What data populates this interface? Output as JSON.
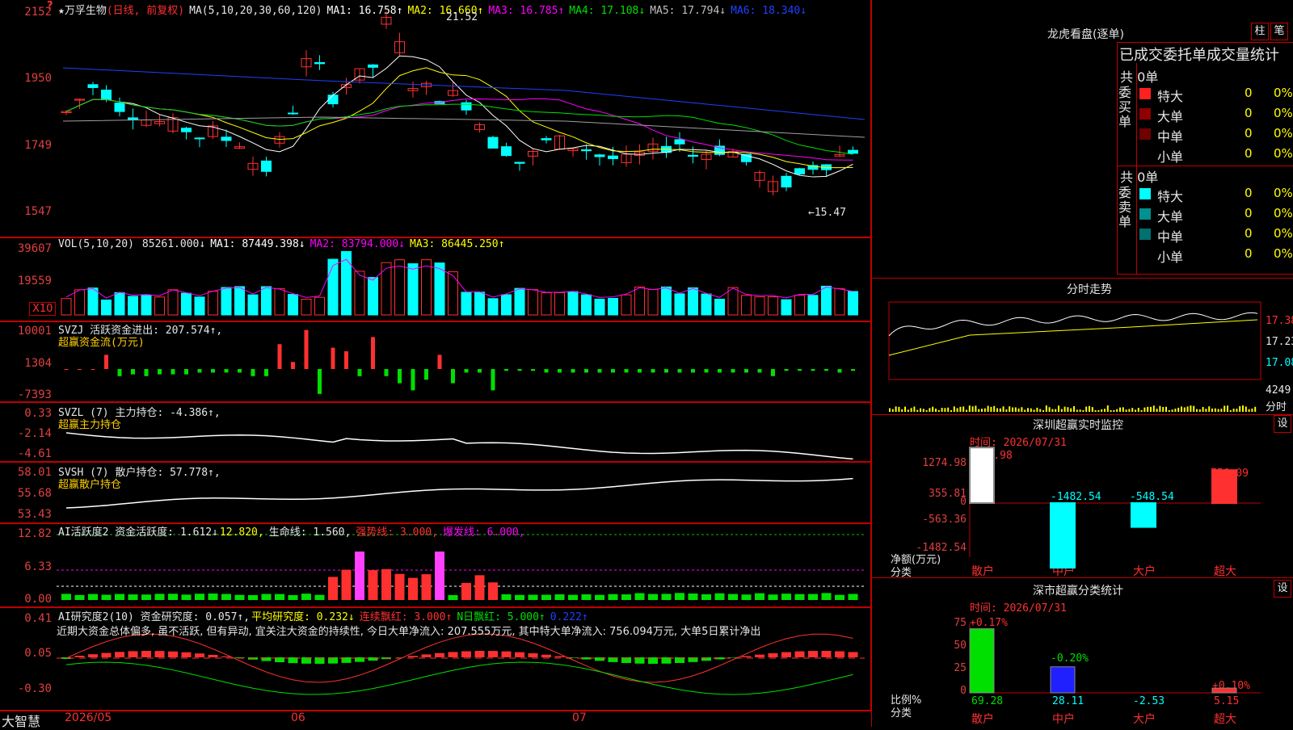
{
  "colors": {
    "up": "#ff3030",
    "down": "#00ffff",
    "ma1": "#ffffff",
    "ma2": "#ffff00",
    "ma3": "#ff00ff",
    "ma4": "#00e000",
    "ma5": "#a0a0a0",
    "ma6": "#2040ff",
    "frame": "#c00000",
    "volup": "#ff3030",
    "voldn": "#00ffff",
    "text": "#e6e6e6",
    "green": "#00e000"
  },
  "main": {
    "stock_label": "★万孚生物",
    "mode_label": "(日线, 前复权)",
    "ma_params": "MA(5,10,20,30,60,120)",
    "ma": [
      {
        "label": "MA1: 16.758↑",
        "color": "#ffffff"
      },
      {
        "label": "MA2: 16.660↑",
        "color": "#ffff00"
      },
      {
        "label": "MA3: 16.785↑",
        "color": "#ff00ff"
      },
      {
        "label": "MA4: 17.108↓",
        "color": "#00e000"
      },
      {
        "label": "MA5: 17.794↓",
        "color": "#c0c0c0"
      },
      {
        "label": "MA6: 18.340↓",
        "color": "#2040ff"
      }
    ],
    "yticks": [
      "2152",
      "1950",
      "1749",
      "1547"
    ],
    "high_label": "21.52",
    "low_label": "←15.47",
    "corner_mark": "?"
  },
  "vol": {
    "title": "VOL(5,10,20)",
    "value": "85261.000↓",
    "ma": [
      {
        "label": "MA1: 87449.398↓",
        "color": "#ffffff"
      },
      {
        "label": "MA2: 83794.000↓",
        "color": "#ff00ff"
      },
      {
        "label": "MA3: 86445.250↑",
        "color": "#ffff00"
      }
    ],
    "yticks": [
      "39607",
      "19559"
    ],
    "unit": "X10"
  },
  "svzj": {
    "line1": "SVZJ  活跃资金进出: 207.574↑,",
    "line2": "超赢资金流(万元)",
    "yticks": [
      "10001",
      "1304",
      "-7393"
    ]
  },
  "svzl": {
    "line1": "SVZL (7) 主力持仓: -4.386↑,",
    "line2": "超赢主力持仓",
    "yticks": [
      "0.33",
      "-2.14",
      "-4.61"
    ]
  },
  "svsh": {
    "line1": "SVSH (7) 散户持仓: 57.778↑,",
    "line2": "超赢散户持仓",
    "yticks": [
      "58.01",
      "55.68",
      "53.43"
    ]
  },
  "ai1": {
    "title": "AI活跃度2 资金活跃度: 1.612↓",
    "v2": "12.820,",
    "v3": "生命线: 1.560,",
    "v4": "强势线: 3.000,",
    "v5": "爆发线: 6.000,",
    "yticks": [
      "12.82",
      "6.33",
      "0.00"
    ]
  },
  "ai2": {
    "title": "AI研究度2(10) 资金研究度: 0.057↑,",
    "v2": "平均研究度: 0.232↓",
    "v3": "连续飘红: 3.000↑",
    "v4": "N日飘红: 5.000↑",
    "v5": "0.222↑",
    "desc": "近期大资金总体偏多, 虽不活跃, 但有异动, 宜关注大资金的持续性, 今日大单净流入: 207.555万元, 其中特大单净流入: 756.094万元, 大单5日累计净出",
    "yticks": [
      "0.41",
      "0.05",
      "-0.30"
    ]
  },
  "xaxis": {
    "brand": "大智慧",
    "labels": [
      "2026/05",
      "06",
      "07"
    ]
  },
  "side": {
    "dragon_title": "龙虎看盘(逐单)",
    "btn_zhu": "柱",
    "btn_bi": "笔",
    "stat_title": "已成交委托单成交量统计",
    "buy": {
      "group": "委买单",
      "total": "共 0单",
      "rows": [
        {
          "name": "特大",
          "val": "0",
          "pct": "0%",
          "color": "#ff2020"
        },
        {
          "name": "大单",
          "val": "0",
          "pct": "0%",
          "color": "#900000"
        },
        {
          "name": "中单",
          "val": "0",
          "pct": "0%",
          "color": "#700000"
        },
        {
          "name": "小单",
          "val": "0",
          "pct": "0%",
          "color": "#000000"
        }
      ]
    },
    "sell": {
      "group": "委卖单",
      "total": "共 0单",
      "rows": [
        {
          "name": "特大",
          "val": "0",
          "pct": "0%",
          "color": "#00ffff"
        },
        {
          "name": "大单",
          "val": "0",
          "pct": "0%",
          "color": "#009090"
        },
        {
          "name": "中单",
          "val": "0",
          "pct": "0%",
          "color": "#007070"
        },
        {
          "name": "小单",
          "val": "0",
          "pct": "0%",
          "color": "#000000"
        }
      ]
    },
    "intraday": {
      "title": "分时走势",
      "prices": [
        "17.38",
        "17.23",
        "17.08"
      ],
      "vol": "4249",
      "vol2": "分时"
    },
    "monitor": {
      "title": "深圳超赢实时监控",
      "btn": "设",
      "time": "时间: 2026/07/31",
      "yticks": [
        "1274.98",
        "355.81",
        "0",
        "-563.36",
        "-1482.54"
      ],
      "ylabel": "净额(万元)",
      "xlabel": "分类",
      "cats": [
        "散户",
        "中户",
        "大户",
        "超大"
      ],
      "values": [
        1274.98,
        -1482.54,
        -548.54,
        756.09
      ],
      "labels": [
        "1274.98",
        "-1482.54",
        "-548.54",
        "756.09"
      ]
    },
    "classify": {
      "title": "深市超赢分类统计",
      "btn": "设",
      "time": "时间: 2026/07/31",
      "yticks": [
        "75",
        "50",
        "25",
        "0"
      ],
      "ylabel": "比例%",
      "xlabel": "分类",
      "cats": [
        "散户",
        "中户",
        "大户",
        "超大"
      ],
      "values": [
        69.28,
        28.11,
        -2.53,
        5.15
      ],
      "bottom": [
        "69.28",
        "28.11",
        "-2.53",
        "5.15"
      ],
      "top": [
        "+0.17%",
        "-0.20%",
        "",
        "+0.10%"
      ]
    }
  }
}
